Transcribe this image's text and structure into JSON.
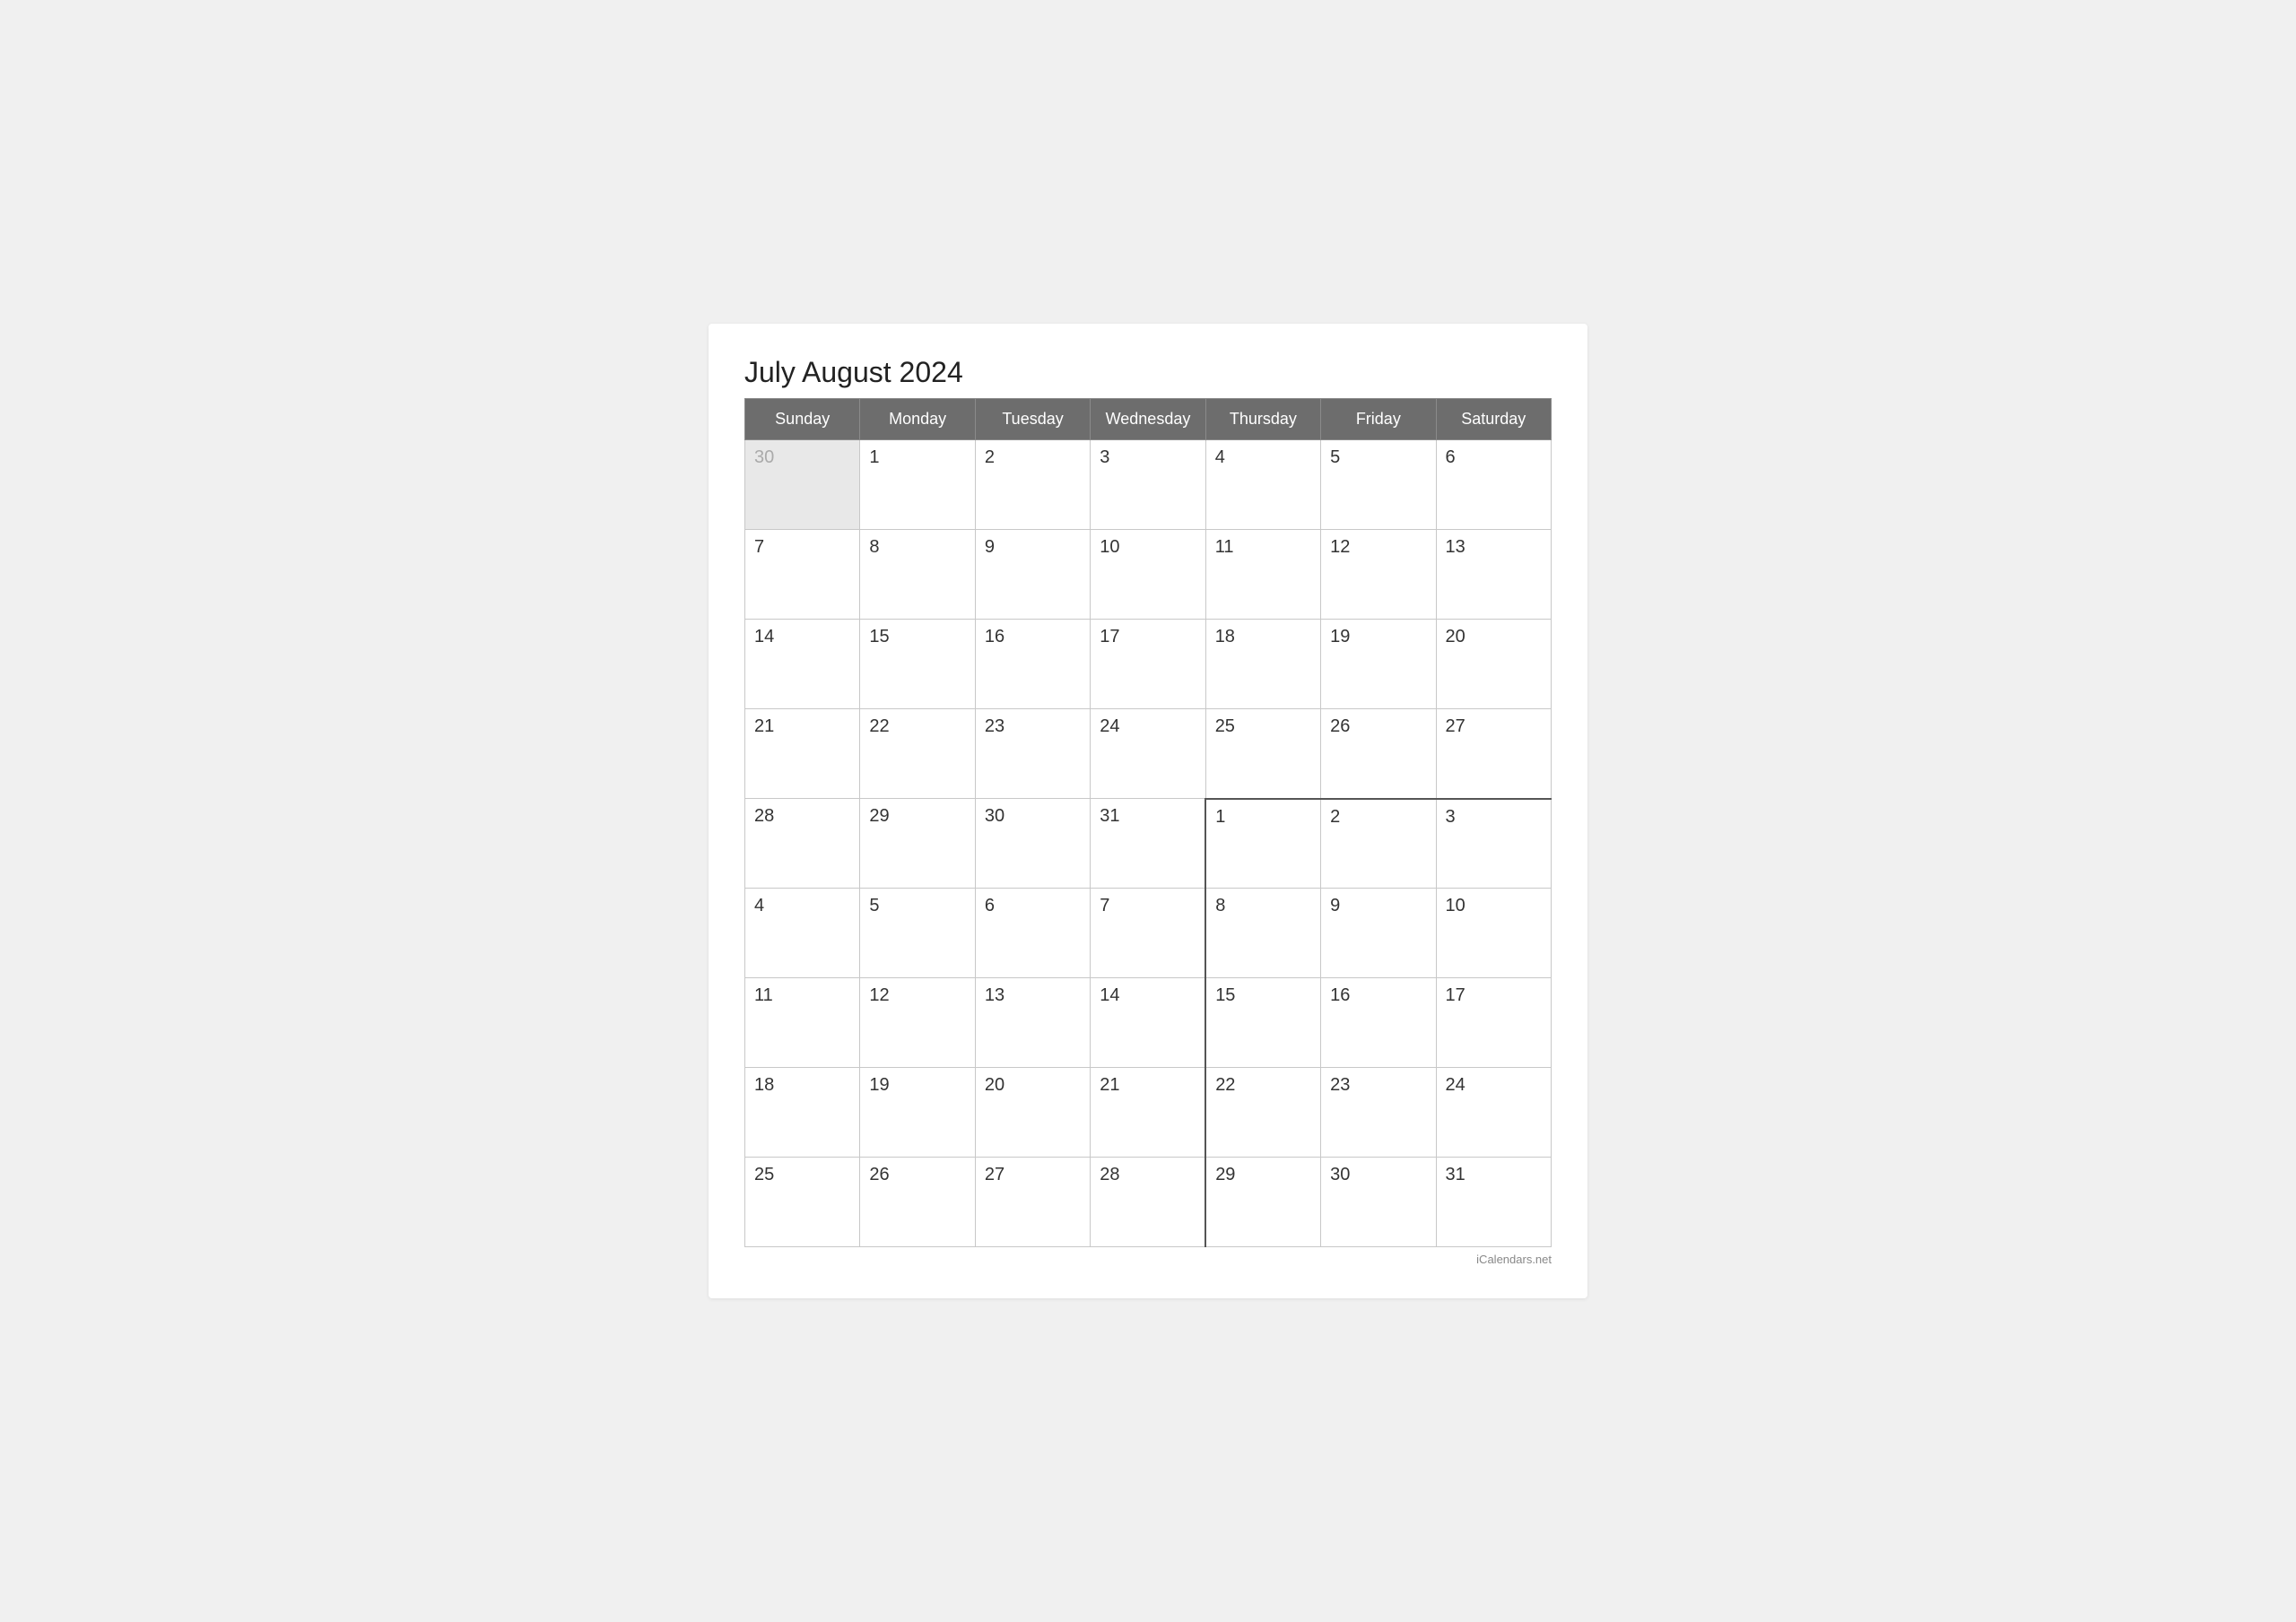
{
  "title": "July August 2024",
  "footer": "iCalendars.net",
  "header": {
    "days": [
      "Sunday",
      "Monday",
      "Tuesday",
      "Wednesday",
      "Thursday",
      "Friday",
      "Saturday"
    ]
  },
  "weeks": [
    [
      {
        "day": "30",
        "type": "prev-month"
      },
      {
        "day": "1",
        "type": "current"
      },
      {
        "day": "2",
        "type": "current"
      },
      {
        "day": "3",
        "type": "current"
      },
      {
        "day": "4",
        "type": "current"
      },
      {
        "day": "5",
        "type": "current"
      },
      {
        "day": "6",
        "type": "current"
      }
    ],
    [
      {
        "day": "7",
        "type": "current"
      },
      {
        "day": "8",
        "type": "current"
      },
      {
        "day": "9",
        "type": "current"
      },
      {
        "day": "10",
        "type": "current"
      },
      {
        "day": "11",
        "type": "current"
      },
      {
        "day": "12",
        "type": "current"
      },
      {
        "day": "13",
        "type": "current"
      }
    ],
    [
      {
        "day": "14",
        "type": "current"
      },
      {
        "day": "15",
        "type": "current"
      },
      {
        "day": "16",
        "type": "current"
      },
      {
        "day": "17",
        "type": "current"
      },
      {
        "day": "18",
        "type": "current"
      },
      {
        "day": "19",
        "type": "current"
      },
      {
        "day": "20",
        "type": "current"
      }
    ],
    [
      {
        "day": "21",
        "type": "current"
      },
      {
        "day": "22",
        "type": "current"
      },
      {
        "day": "23",
        "type": "current"
      },
      {
        "day": "24",
        "type": "current"
      },
      {
        "day": "25",
        "type": "current"
      },
      {
        "day": "26",
        "type": "current"
      },
      {
        "day": "27",
        "type": "current"
      }
    ],
    [
      {
        "day": "28",
        "type": "current"
      },
      {
        "day": "29",
        "type": "current"
      },
      {
        "day": "30",
        "type": "current"
      },
      {
        "day": "31",
        "type": "current"
      },
      {
        "day": "1",
        "type": "next-month month-boundary-top month-boundary-left"
      },
      {
        "day": "2",
        "type": "next-month month-boundary-top"
      },
      {
        "day": "3",
        "type": "next-month month-boundary-top"
      }
    ],
    [
      {
        "day": "4",
        "type": "current"
      },
      {
        "day": "5",
        "type": "current"
      },
      {
        "day": "6",
        "type": "current"
      },
      {
        "day": "7",
        "type": "current"
      },
      {
        "day": "8",
        "type": "next-month month-boundary-left"
      },
      {
        "day": "9",
        "type": "next-month"
      },
      {
        "day": "10",
        "type": "next-month"
      }
    ],
    [
      {
        "day": "11",
        "type": "current"
      },
      {
        "day": "12",
        "type": "current"
      },
      {
        "day": "13",
        "type": "current"
      },
      {
        "day": "14",
        "type": "current"
      },
      {
        "day": "15",
        "type": "next-month month-boundary-left"
      },
      {
        "day": "16",
        "type": "next-month"
      },
      {
        "day": "17",
        "type": "next-month"
      }
    ],
    [
      {
        "day": "18",
        "type": "current"
      },
      {
        "day": "19",
        "type": "current"
      },
      {
        "day": "20",
        "type": "current"
      },
      {
        "day": "21",
        "type": "current"
      },
      {
        "day": "22",
        "type": "next-month month-boundary-left"
      },
      {
        "day": "23",
        "type": "next-month"
      },
      {
        "day": "24",
        "type": "next-month"
      }
    ],
    [
      {
        "day": "25",
        "type": "current"
      },
      {
        "day": "26",
        "type": "current"
      },
      {
        "day": "27",
        "type": "current"
      },
      {
        "day": "28",
        "type": "current"
      },
      {
        "day": "29",
        "type": "next-month month-boundary-left"
      },
      {
        "day": "30",
        "type": "next-month"
      },
      {
        "day": "31",
        "type": "next-month"
      }
    ]
  ]
}
